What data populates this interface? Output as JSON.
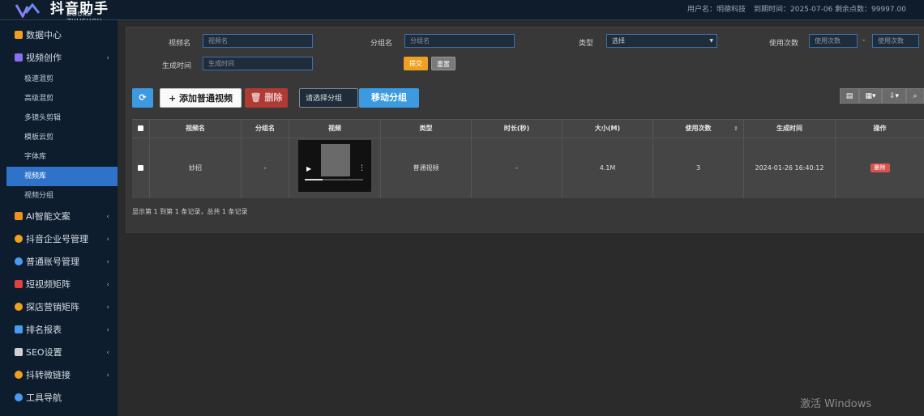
{
  "header": {
    "logo_title": "抖音助手",
    "logo_subtitle": "DOUKE ZHUSHOU",
    "user": "用户名：明德科技",
    "expire": "到期时间：2025-07-06",
    "remaining": "剩余点数：99997.00"
  },
  "sidebar": {
    "items": [
      {
        "label": "数据中心",
        "color": "#f0a020"
      },
      {
        "label": "视频创作",
        "color": "#8a6ff0"
      },
      {
        "label": "AI智能文案",
        "color": "#f09020"
      },
      {
        "label": "抖音企业号管理",
        "color": "#f0a020"
      },
      {
        "label": "普通账号管理",
        "color": "#4a9af0"
      },
      {
        "label": "短视频矩阵",
        "color": "#e04040"
      },
      {
        "label": "探店营销矩阵",
        "color": "#f0a020"
      },
      {
        "label": "排名报表",
        "color": "#4a9af0"
      },
      {
        "label": "SEO设置",
        "color": "#d0d0d0"
      },
      {
        "label": "抖转微链接",
        "color": "#f0a020"
      },
      {
        "label": "工具导航",
        "color": "#4a9af0"
      }
    ],
    "sub_items": [
      "极速混剪",
      "高级混剪",
      "多镜头剪辑",
      "模板云剪",
      "字体库",
      "视频库",
      "视频分组"
    ],
    "active_sub": "视频库"
  },
  "filters": {
    "video_name_label": "视频名",
    "video_name_placeholder": "视频名",
    "group_name_label": "分组名",
    "group_name_placeholder": "分组名",
    "type_label": "类型",
    "type_value": "选择",
    "use_count_label": "使用次数",
    "use_count_min_placeholder": "使用次数",
    "use_count_sep": "-",
    "use_count_max_placeholder": "使用次数",
    "created_label": "生成时间",
    "created_placeholder": "生成时间",
    "submit": "提交",
    "reset": "重置"
  },
  "toolbar": {
    "add": "添加普通视频",
    "delete": "删除",
    "group_select": "请选择分组",
    "move_group": "移动分组"
  },
  "table": {
    "columns": [
      "视频名",
      "分组名",
      "视频",
      "类型",
      "时长(秒)",
      "大小(M)",
      "使用次数",
      "生成时间",
      "操作"
    ],
    "rows": [
      {
        "name": "妙招",
        "group": "-",
        "type": "普通视频",
        "duration": "-",
        "size": "4.1M",
        "count": "3",
        "created": "2024-01-26 16:40:12",
        "action": "删除"
      }
    ]
  },
  "pagination": "显示第 1 到第 1 条记录，总共 1 条记录",
  "watermark": "激活 Windows"
}
